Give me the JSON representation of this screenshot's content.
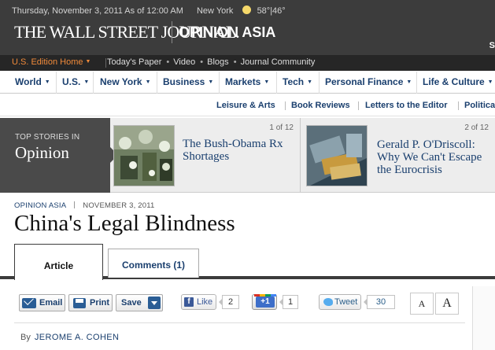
{
  "header": {
    "dateline": "Thursday, November 3, 2011 As of 12:00 AM",
    "city": "New York",
    "weather": "58°|46°",
    "logo": "THE WALL STREET JOURNAL.",
    "section": "OPINION ASIA",
    "edge_letter": "S"
  },
  "edition_bar": {
    "edition": "U.S. Edition Home",
    "links": [
      "Today's Paper",
      "Video",
      "Blogs",
      "Journal Community"
    ]
  },
  "main_nav": [
    "World",
    "U.S.",
    "New York",
    "Business",
    "Markets",
    "Tech",
    "Personal Finance",
    "Life & Culture"
  ],
  "sub_nav": [
    "Leisure & Arts",
    "Book Reviews",
    "Letters to the Editor",
    "Politica"
  ],
  "top_stories": {
    "label_small": "TOP STORIES IN",
    "label_big": "Opinion",
    "stories": [
      {
        "counter": "1 of 12",
        "headline": "The Bush-Obama Rx Shortages"
      },
      {
        "counter": "2 of 12",
        "headline": "Gerald P. O'Driscoll: Why We Can't Escape the Eurocrisis"
      }
    ]
  },
  "article": {
    "kicker": "OPINION ASIA",
    "date": "NOVEMBER 3, 2011",
    "title": "China's Legal Blindness",
    "tabs": [
      {
        "label": "Article"
      },
      {
        "label": "Comments (1)"
      }
    ],
    "byline_prefix": "By",
    "author": "JEROME A. COHEN"
  },
  "toolbar": {
    "email": "Email",
    "print": "Print",
    "save": "Save",
    "like": "Like",
    "like_count": "2",
    "gplus": "+1",
    "gplus_count": "1",
    "tweet": "Tweet",
    "tweet_count": "30",
    "font_small": "A",
    "font_large": "A"
  },
  "colors": {
    "masthead": "#3c3c3c",
    "edition_accent": "#f08a3a",
    "link_blue": "#1a3f6e"
  }
}
